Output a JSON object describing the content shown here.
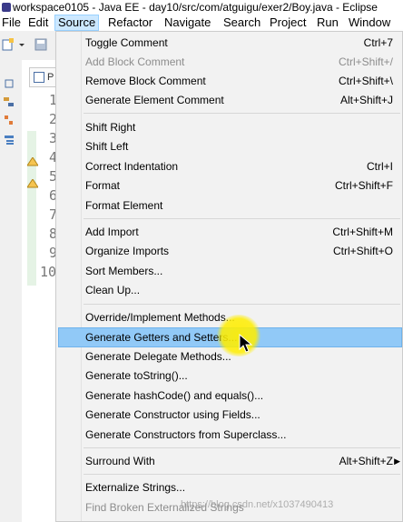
{
  "window": {
    "title": "workspace0105 - Java EE - day10/src/com/atguigu/exer2/Boy.java - Eclipse"
  },
  "menubar": {
    "items": [
      "File",
      "Edit",
      "Source",
      "Refactor",
      "Navigate",
      "Search",
      "Project",
      "Run",
      "Window"
    ],
    "active": "Source"
  },
  "editor": {
    "tab_label": "P",
    "line_numbers": [
      "1",
      "2",
      "3",
      "4",
      "5",
      "6",
      "7",
      "8",
      "9",
      "10"
    ]
  },
  "source_menu": {
    "items": [
      {
        "label": "Toggle Comment",
        "accel": "Ctrl+7",
        "enabled": true
      },
      {
        "label": "Add Block Comment",
        "accel": "Ctrl+Shift+/",
        "enabled": false
      },
      {
        "label": "Remove Block Comment",
        "accel": "Ctrl+Shift+\\",
        "enabled": true
      },
      {
        "label": "Generate Element Comment",
        "accel": "Alt+Shift+J",
        "enabled": true
      },
      {
        "label": "Shift Right",
        "accel": "",
        "enabled": true
      },
      {
        "label": "Shift Left",
        "accel": "",
        "enabled": true
      },
      {
        "label": "Correct Indentation",
        "accel": "Ctrl+I",
        "enabled": true
      },
      {
        "label": "Format",
        "accel": "Ctrl+Shift+F",
        "enabled": true
      },
      {
        "label": "Format Element",
        "accel": "",
        "enabled": true
      },
      {
        "label": "Add Import",
        "accel": "Ctrl+Shift+M",
        "enabled": true
      },
      {
        "label": "Organize Imports",
        "accel": "Ctrl+Shift+O",
        "enabled": true
      },
      {
        "label": "Sort Members...",
        "accel": "",
        "enabled": true
      },
      {
        "label": "Clean Up...",
        "accel": "",
        "enabled": true
      },
      {
        "label": "Override/Implement Methods...",
        "accel": "",
        "enabled": true
      },
      {
        "label": "Generate Getters and Setters...",
        "accel": "",
        "enabled": true,
        "highlighted": true
      },
      {
        "label": "Generate Delegate Methods...",
        "accel": "",
        "enabled": true
      },
      {
        "label": "Generate toString()...",
        "accel": "",
        "enabled": true
      },
      {
        "label": "Generate hashCode() and equals()...",
        "accel": "",
        "enabled": true
      },
      {
        "label": "Generate Constructor using Fields...",
        "accel": "",
        "enabled": true
      },
      {
        "label": "Generate Constructors from Superclass...",
        "accel": "",
        "enabled": true
      },
      {
        "label": "Surround With",
        "accel": "Alt+Shift+Z",
        "enabled": true,
        "submenu": true
      },
      {
        "label": "Externalize Strings...",
        "accel": "",
        "enabled": true
      },
      {
        "label": "Find Broken Externalized Strings",
        "accel": "",
        "enabled": false
      }
    ]
  },
  "watermark": "https://blog.csdn.net/x1037490413",
  "colors": {
    "highlight": "#91c9f7",
    "menubar_active": "#cce8ff",
    "disabled_text": "#8d8d8d",
    "cursor_spot": "#ffee00"
  }
}
